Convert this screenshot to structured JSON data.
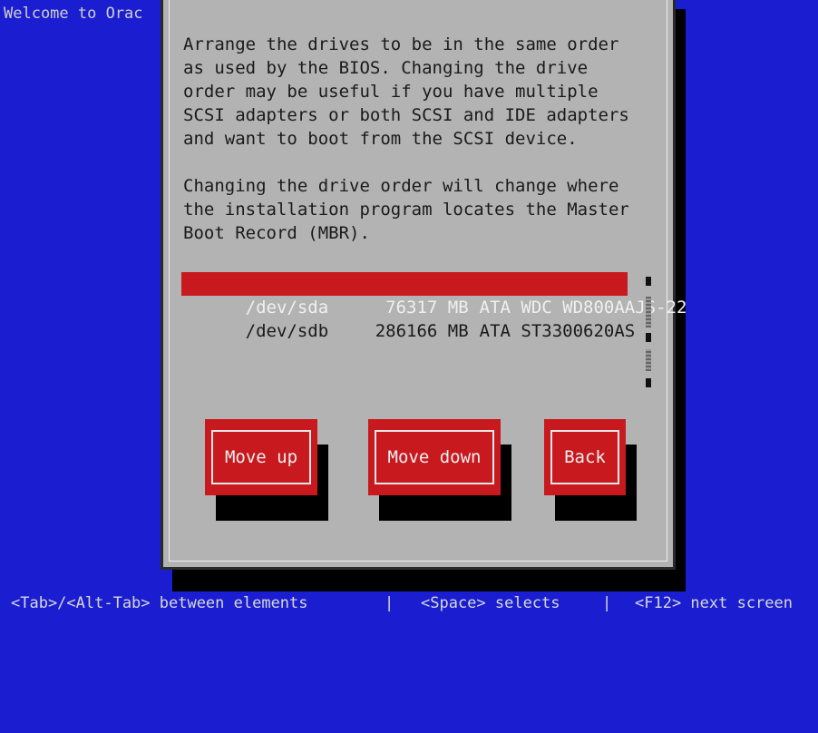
{
  "window": {
    "welcome_text": "Welcome to Orac"
  },
  "dialog": {
    "paragraph1": "Arrange the drives to be in the same order\nas used by the BIOS. Changing the drive\norder may be useful if you have multiple\nSCSI adapters or both SCSI and IDE adapters\nand want to boot from the SCSI device.",
    "paragraph2": "Changing the drive order will change where\nthe installation program locates the Master\nBoot Record (MBR).",
    "drives": [
      {
        "device": "/dev/sda",
        "size": "76317 MB",
        "model": "ATA WDC WD800AAJS-22",
        "selected": true
      },
      {
        "device": "/dev/sdb",
        "size": "286166 MB",
        "model": "ATA ST3300620AS",
        "selected": false
      }
    ],
    "buttons": {
      "move_up": "Move up",
      "move_down": "Move down",
      "back": "Back"
    }
  },
  "footer": {
    "tab_hint": "<Tab>/<Alt-Tab> between elements",
    "separator": "|",
    "space_hint": "<Space> selects",
    "f12_hint": "<F12> next screen"
  },
  "colors": {
    "background": "#1a1ed0",
    "dialog": "#b3b3b3",
    "accent": "#c8191f"
  }
}
